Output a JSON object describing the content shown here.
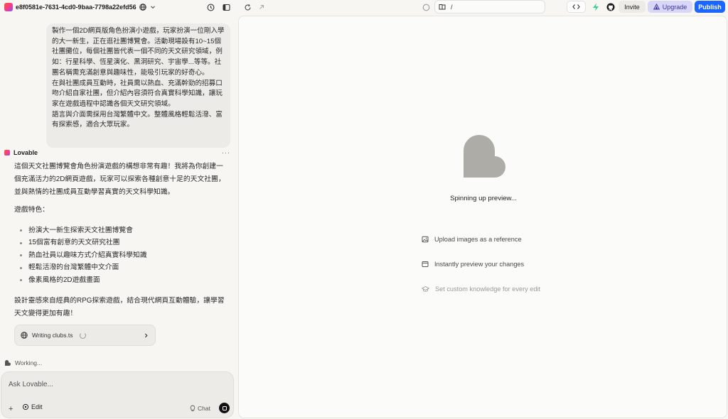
{
  "topbar": {
    "project_name": "e8f0581e-7631-4cd0-9baa-7798a22efd56",
    "url_path": "/",
    "invite_label": "Invite",
    "upgrade_label": "Upgrade",
    "publish_label": "Publish",
    "icons": [
      "globe-icon",
      "chevron-down-icon",
      "history-icon",
      "sidebar-toggle-icon",
      "refresh-icon",
      "open-external-icon",
      "device-icon",
      "page-icon",
      "code-icon",
      "bolt-icon",
      "github-icon",
      "upgrade-icon"
    ]
  },
  "chat": {
    "user_message": [
      "製作一個2D網頁版角色扮演小遊戲，玩家扮演一位剛入學的大一新生，正在逛社團博覽會。活動現場設有10~15個社團攤位，每個社團皆代表一個不同的天文研究領域，例如：行星科學、恆星演化、黑洞研究、宇宙學...等等。社團名稱需充滿創意與趣味性，能吸引玩家的好奇心。",
      "在與社團成員互動時，社員需以熱血、充滿幹勁的招募口吻介紹自家社團，但介紹內容須符合真實科學知識，讓玩家在遊戲過程中認識各個天文研究領域。",
      "語言與介面需採用台灣繁體中文。整體風格輕鬆活潑、富有探索感，適合大眾玩家。"
    ],
    "assistant_name": "Lovable",
    "assistant_more": "···",
    "assistant_intro": "這個天文社團博覽會角色扮演遊戲的構想非常有趣！我將為你創建一個充滿活力的2D網頁遊戲，玩家可以探索各種創意十足的天文社團，並與熱情的社團成員互動學習真實的天文科學知識。",
    "features_title": "遊戲特色：",
    "features": [
      "扮演大一新生探索天文社團博覽會",
      "15個富有創意的天文研究社團",
      "熱血社員以趣味方式介紹真實科學知識",
      "輕鬆活潑的台灣繁體中文介面",
      "像素風格的2D遊戲畫面"
    ],
    "assistant_outro": "設計靈感來自經典的RPG探索遊戲，結合現代網頁互動體驗，讓學習天文變得更加有趣！",
    "writing_file": "Writing clubs.ts",
    "working_status": "Working...",
    "composer_placeholder": "Ask Lovable...",
    "edit_label": "Edit",
    "chat_label": "Chat"
  },
  "preview": {
    "status": "Spinning up preview...",
    "tips": [
      {
        "icon": "image-icon",
        "label": "Upload images as a reference"
      },
      {
        "icon": "preview-icon",
        "label": "Instantly preview your changes"
      },
      {
        "icon": "knowledge-icon",
        "label": "Set custom knowledge for every edit"
      }
    ]
  },
  "colors": {
    "publish": "#1a66ff",
    "upgrade_bg": "#d9d7f7",
    "upgrade_text": "#3b3596",
    "heart": "#aeaca7"
  }
}
